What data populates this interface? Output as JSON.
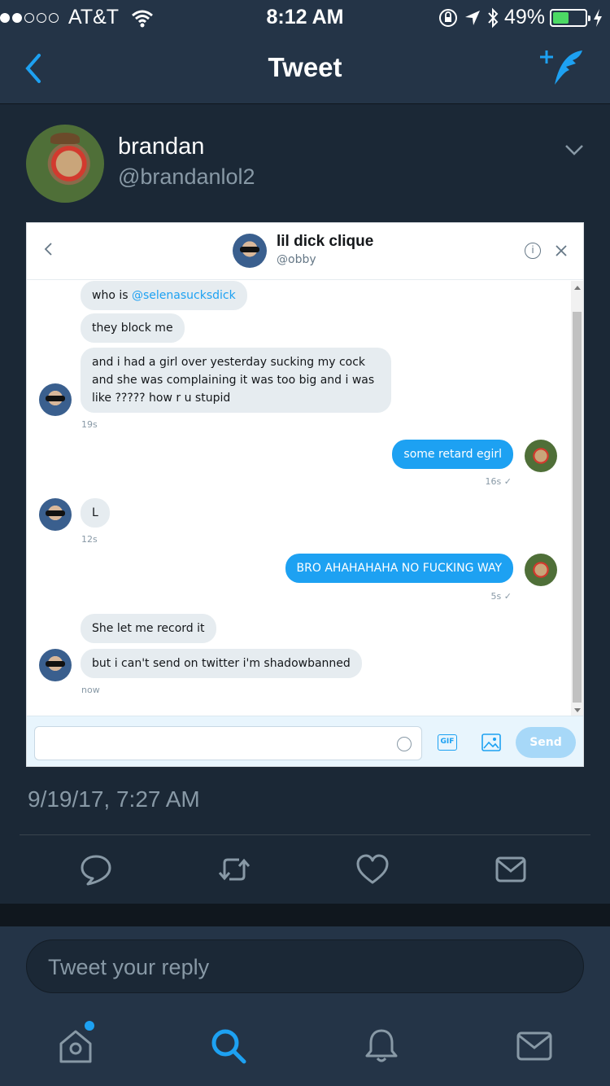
{
  "status_bar": {
    "carrier": "AT&T",
    "time": "8:12 AM",
    "battery": "49%",
    "battery_level": 0.49
  },
  "nav": {
    "title": "Tweet"
  },
  "tweet": {
    "author_name": "brandan",
    "author_handle": "@brandanlol2",
    "timestamp": "9/19/17, 7:27 AM"
  },
  "dm": {
    "title": "lil dick clique",
    "subtitle": "@obby",
    "messages": {
      "m1_prefix": "who is ",
      "m1_link": "@selenasucksdick",
      "m2": "they block me",
      "m3": "and i had a girl over yesterday sucking my cock and she was complaining it was too big and i was like ????? how r u stupid",
      "t3": "19s",
      "m4": "some retard egirl",
      "t4": "16s ✓",
      "m5": "L",
      "t5": "12s",
      "m6": "BRO AHAHAHAHA NO FUCKING WAY",
      "t6": "5s ✓",
      "m7": "She let me record it",
      "m8": "but i can't send on twitter i'm shadowbanned",
      "t8": "now"
    },
    "gif_label": "GIF",
    "send_label": "Send"
  },
  "reply": {
    "placeholder": "Tweet your reply"
  },
  "colors": {
    "accent": "#1da1f2",
    "background": "#1b2836",
    "bar": "#243447",
    "muted": "#8899a6"
  }
}
